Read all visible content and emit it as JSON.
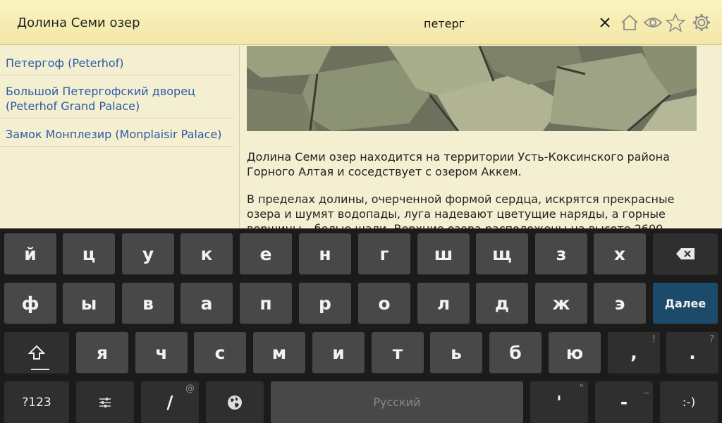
{
  "header": {
    "title": "Долина Семи озер",
    "search_value": "петерг",
    "icons": [
      "close-icon",
      "home-icon",
      "eye-icon",
      "star-icon",
      "gear-icon"
    ]
  },
  "sidebar": {
    "items": [
      {
        "label": "Петергоф (Peterhof)"
      },
      {
        "label": "Большой Петергофский дворец (Peterhof Grand Palace)"
      },
      {
        "label": "Замок Монплезир (Monplaisir Palace)"
      }
    ]
  },
  "article": {
    "paragraph1": " Долина Семи озер находится на территории Усть-Коксинского района Горного Алтая и соседствует с озером Аккем.",
    "paragraph2": " В пределах долины, очерченной формой сердца, искрятся прекрасные озера и шумят водопады, луга надевают цветущие наряды, а горные вершины – белые шали. Верхние озера расположены на высоте 2600"
  },
  "keyboard": {
    "row1": [
      "й",
      "ц",
      "у",
      "к",
      "е",
      "н",
      "г",
      "ш",
      "щ",
      "з",
      "х"
    ],
    "row2": [
      "ф",
      "ы",
      "в",
      "а",
      "п",
      "р",
      "о",
      "л",
      "д",
      "ж",
      "э"
    ],
    "row3": [
      "я",
      "ч",
      "с",
      "м",
      "и",
      "т",
      "ь",
      "б",
      "ю"
    ],
    "comma": ",",
    "comma_hint": "!",
    "period": ".",
    "period_hint": "?",
    "enter_label": "Далее",
    "symbols_label": "?123",
    "slash_label": "/",
    "slash_hint": "@",
    "space_label": "Русский",
    "apostrophe_label": "'",
    "apostrophe_hint": "\"",
    "dash_label": "-",
    "dash_hint": "_",
    "smiley_label": ":-)"
  },
  "colors": {
    "link": "#2b5aa2",
    "enter_key": "#1c4a6a",
    "header_bg": "#f3e7a7"
  }
}
